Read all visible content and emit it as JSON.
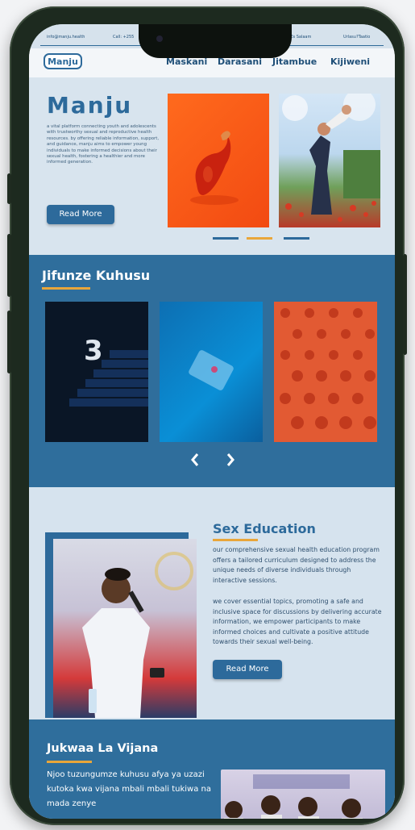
{
  "topbar": {
    "email": "info@manju.health",
    "phone": "Call: +255",
    "location": "...lle, Dar Es Salaam",
    "support": "Urlasu?Taatio"
  },
  "nav": {
    "logo": "Manju",
    "items": [
      "Maskani",
      "Darasani",
      "Jitambue",
      "Kijiweni"
    ]
  },
  "hero": {
    "title": "Manju",
    "description": "a vital platform connecting youth and adolescents with trustworthy sexual and reproductive health resources. by offering reliable information, support, and guidance, manju aims to empower young individuals to make informed decisions about their sexual health, fostering a healthier and more informed generation.",
    "button": "Read More"
  },
  "section2": {
    "title": "Jifunze Kuhusu",
    "prev_icon": "chevron-left-icon",
    "next_icon": "chevron-right-icon"
  },
  "section3": {
    "title": "Sex Education",
    "paragraph1": "our comprehensive sexual health education program offers a tailored curriculum designed to address the unique needs of diverse individuals through interactive sessions.",
    "paragraph2": "we cover essential topics, promoting a safe and inclusive space for discussions by delivering accurate information, we empower participants to make informed choices and cultivate a positive attitude towards their sexual well-being.",
    "button": "Read More"
  },
  "section4": {
    "title": "Jukwaa La Vijana",
    "paragraph": "Njoo tuzungumze kuhusu afya ya uzazi kutoka kwa vijana mbali mbali tukiwa na mada zenye"
  },
  "colors": {
    "primary": "#2d6a9b",
    "accent": "#e9a63a",
    "background_light": "#d8e4ee"
  }
}
